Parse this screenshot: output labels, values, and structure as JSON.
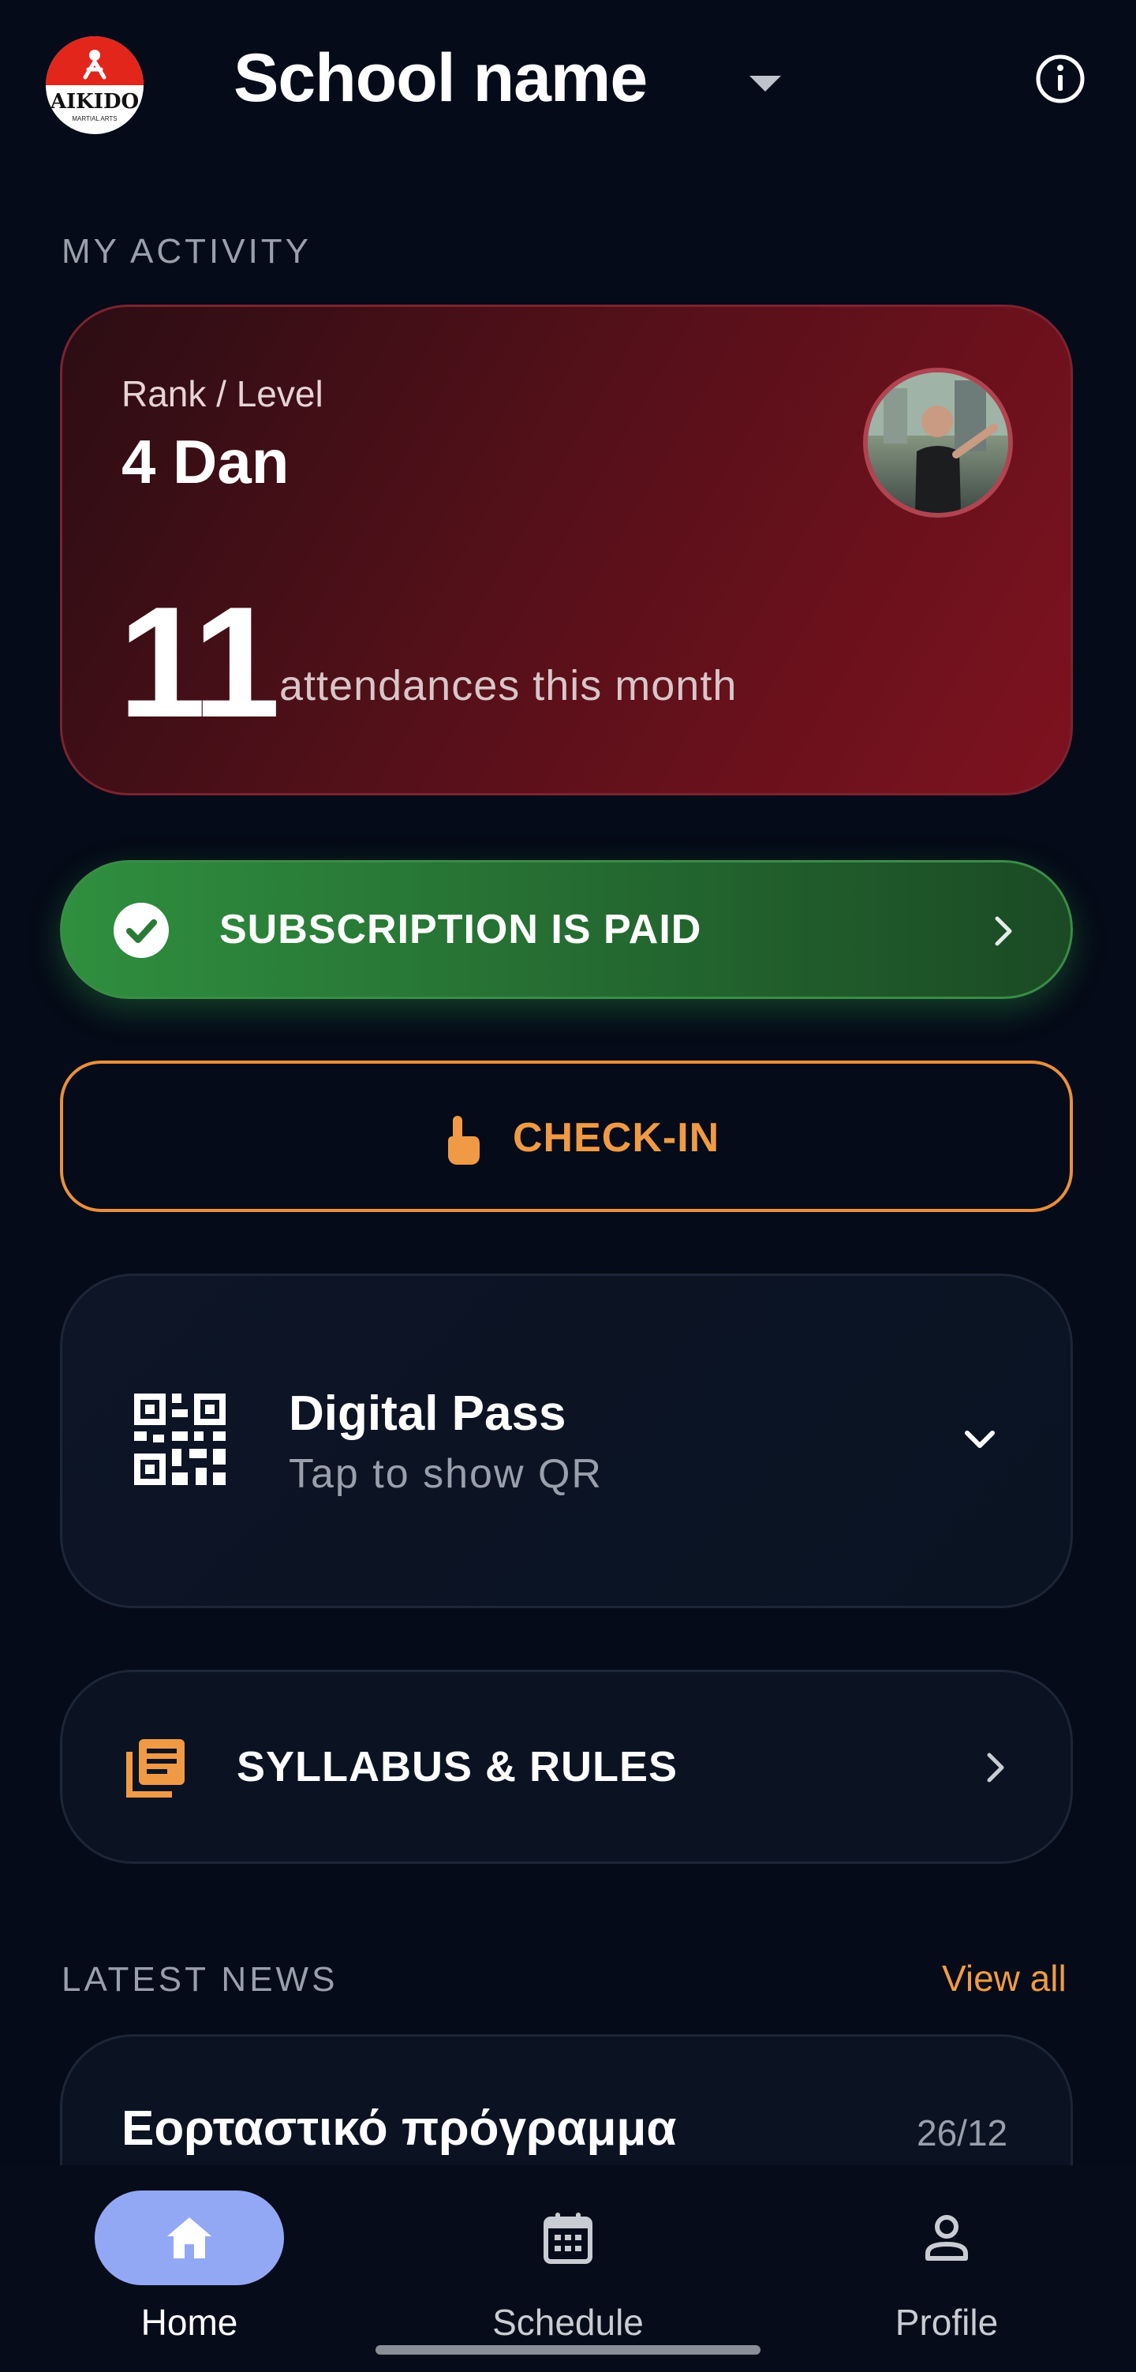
{
  "header": {
    "logo_text": "AIKIDO",
    "logo_subtext": "MARTIAL ARTS",
    "school_name": "School name"
  },
  "activity": {
    "section_label": "MY ACTIVITY",
    "rank_label": "Rank / Level",
    "rank_value": "4 Dan",
    "attendance_count": "11",
    "attendance_text": "attendances this month"
  },
  "subscription": {
    "label": "SUBSCRIPTION IS PAID",
    "status_color": "#2f8f3f"
  },
  "checkin": {
    "label": "CHECK-IN",
    "accent_color": "#f09a45"
  },
  "digital_pass": {
    "title": "Digital Pass",
    "subtitle": "Tap to show QR"
  },
  "syllabus": {
    "label": "SYLLABUS & RULES"
  },
  "news": {
    "section_label": "LATEST NEWS",
    "view_all": "View all",
    "items": [
      {
        "title": "Εορταστικό πρόγραμμα",
        "date": "26/12"
      }
    ]
  },
  "nav": {
    "items": [
      {
        "label": "Home",
        "icon": "home-icon",
        "active": true
      },
      {
        "label": "Schedule",
        "icon": "calendar-icon",
        "active": false
      },
      {
        "label": "Profile",
        "icon": "person-icon",
        "active": false
      }
    ],
    "active_color": "#93a8f5"
  }
}
